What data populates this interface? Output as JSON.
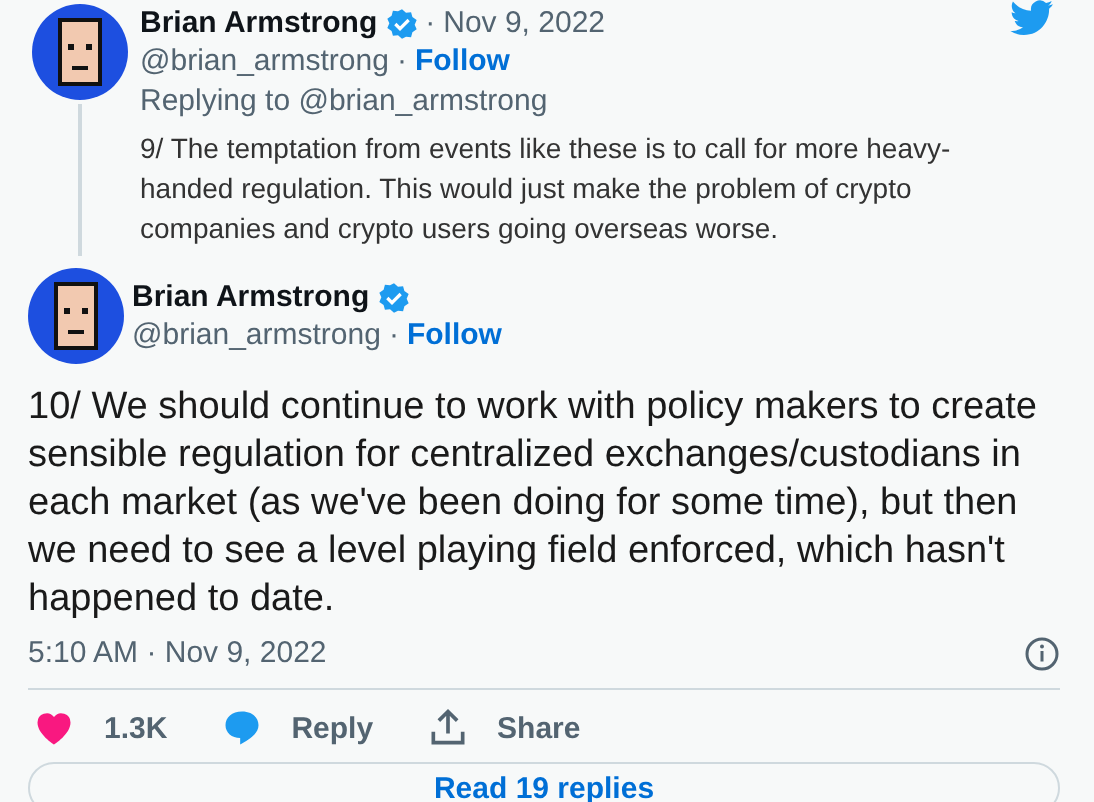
{
  "parent_tweet": {
    "author": {
      "name": "Brian Armstrong",
      "verified": true,
      "handle": "@brian_armstrong",
      "separator": "·",
      "follow": "Follow"
    },
    "date_separator": "·",
    "date": "Nov 9, 2022",
    "replying_to": "Replying to @brian_armstrong",
    "text": "9/ The temptation from events like these is to call for more heavy-handed regulation. This would just make the problem of crypto companies and crypto users going overseas worse."
  },
  "tweet": {
    "author": {
      "name": "Brian Armstrong",
      "verified": true,
      "handle": "@brian_armstrong",
      "separator": "·",
      "follow": "Follow"
    },
    "text": "10/ We should continue to work with policy makers to create sensible regulation for centralized exchanges/custodians in each market (as we've been doing for some time), but then we need to see a level playing field enforced, which hasn't happened to date.",
    "timestamp": "5:10 AM · Nov 9, 2022",
    "actions": [
      {
        "kind": "like",
        "label": "1.3K"
      },
      {
        "kind": "reply",
        "label": "Reply"
      },
      {
        "kind": "share",
        "label": "Share"
      }
    ],
    "read_replies": "Read 19 replies"
  }
}
